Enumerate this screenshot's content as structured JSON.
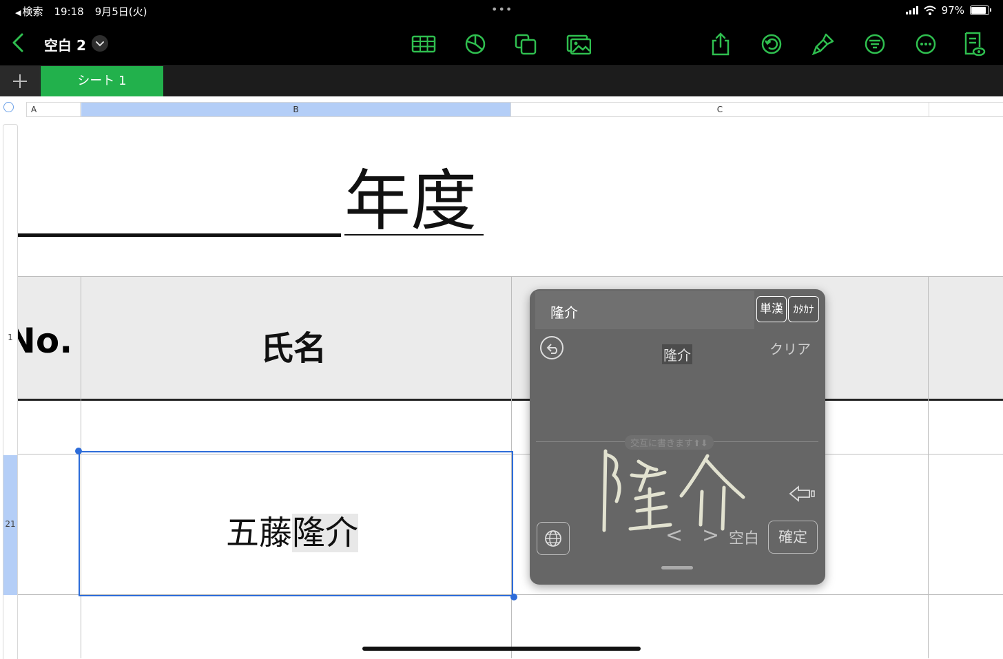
{
  "status_bar": {
    "back_app": "検索",
    "time": "19:18",
    "date": "9月5日(火)",
    "battery_text": "97%",
    "battery_level": 0.97
  },
  "toolbar": {
    "doc_title": "空白 2",
    "accent_color": "#2fbf4f"
  },
  "tabs": {
    "sheet_name": "シート 1",
    "tab_color": "#22b14c"
  },
  "columns": {
    "a": "A",
    "b": "B",
    "c": "C"
  },
  "rows": {
    "header_row": "1",
    "active_row": "21"
  },
  "sheet": {
    "title": "年度",
    "header_no": "No.",
    "header_name": "氏名",
    "cell_prefix": "五藤",
    "cell_marked": "隆介"
  },
  "ime": {
    "composing": "隆介",
    "btn_single_kanji": "単漢",
    "btn_katakana": "ｶﾀｶﾅ",
    "candidate": "隆介",
    "clear": "クリア",
    "hint": "交互に書きます⬆⬇",
    "left_arrow": "<",
    "right_arrow": ">",
    "space": "空白",
    "enter": "確定"
  }
}
